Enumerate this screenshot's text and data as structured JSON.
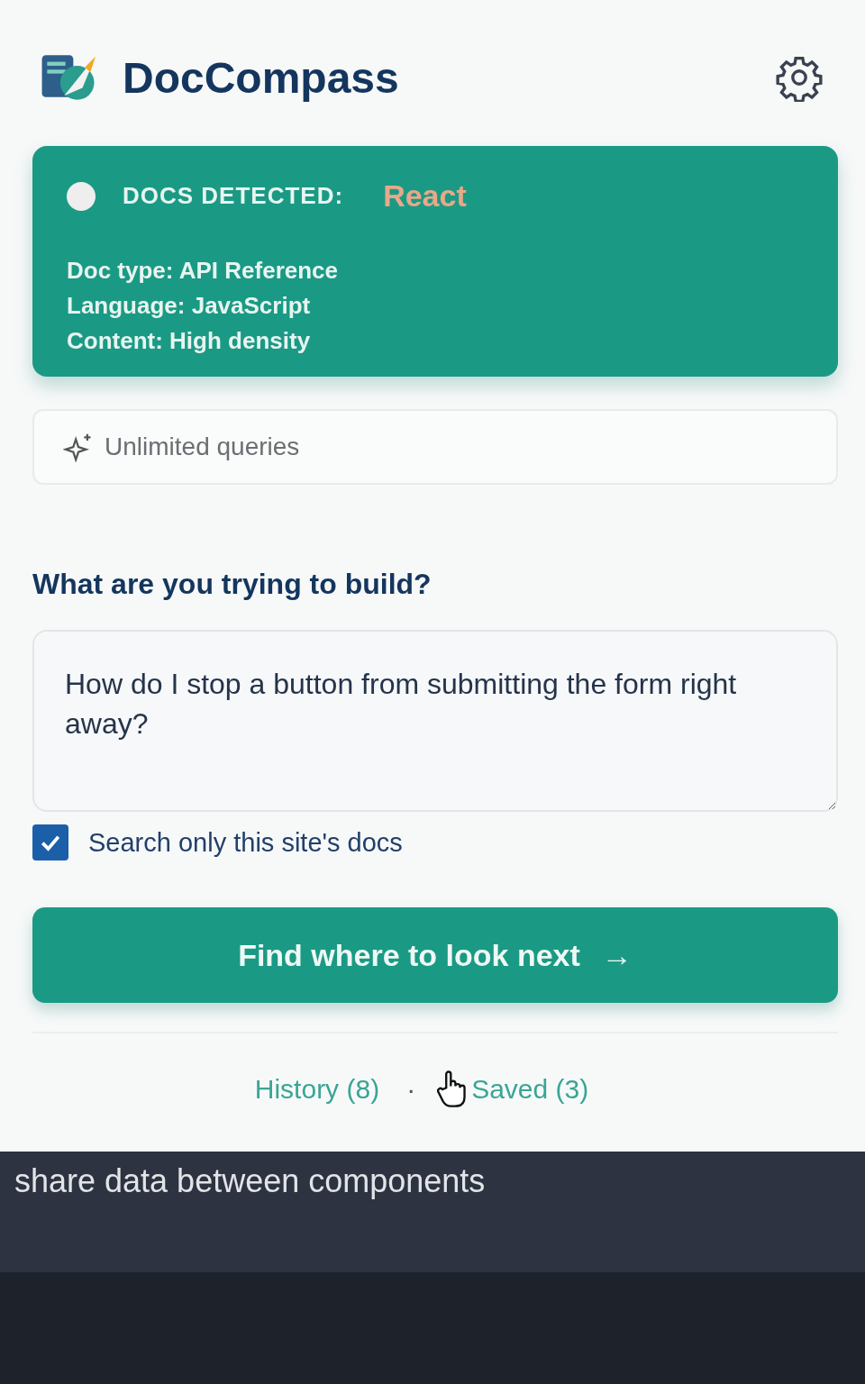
{
  "app": {
    "title": "DocCompass"
  },
  "detection": {
    "label": "DOCS DETECTED:",
    "framework": "React",
    "detected": true,
    "details": [
      "Doc type: API Reference",
      "Language: JavaScript",
      "Content: High density"
    ]
  },
  "plan": {
    "label": "Unlimited queries"
  },
  "question": {
    "heading": "What are you trying to build?",
    "value": "How do I stop a button from submitting the form right away?"
  },
  "scope": {
    "label": "Search only this site's docs",
    "checked": true
  },
  "submit": {
    "label": "Find where to look next",
    "arrow": "→"
  },
  "links": [
    {
      "label": "History (8)"
    },
    {
      "label": "Saved (3)"
    }
  ],
  "separator": "·",
  "background_page": {
    "text": "share data between components"
  }
}
